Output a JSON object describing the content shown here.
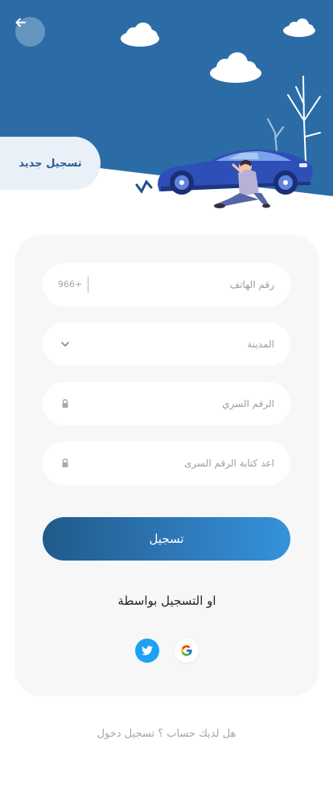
{
  "hero": {
    "new_registration_tab": "تسجيل جديد"
  },
  "form": {
    "phone": {
      "placeholder": "رقم الهاتف",
      "country_code": "966+"
    },
    "city": {
      "placeholder": "المدينة"
    },
    "password": {
      "placeholder": "الرقم السري"
    },
    "confirm_password": {
      "placeholder": "اعد كتابة الرقم السرى"
    },
    "submit_label": "تسجيل",
    "or_register_with": "او  التسجيل بواسطة"
  },
  "footer": {
    "login_prompt": "هل لديك  حساب ؟ تسجيل دخول"
  },
  "colors": {
    "hero_blue": "#2b6ca6",
    "accent": "#2f78b8",
    "twitter": "#1da1f2",
    "card_bg": "#f7f7f7"
  },
  "icons": [
    "arrow-left-icon",
    "chevron-down-icon",
    "lock-icon",
    "twitter-icon",
    "google-icon",
    "logo-icon"
  ]
}
